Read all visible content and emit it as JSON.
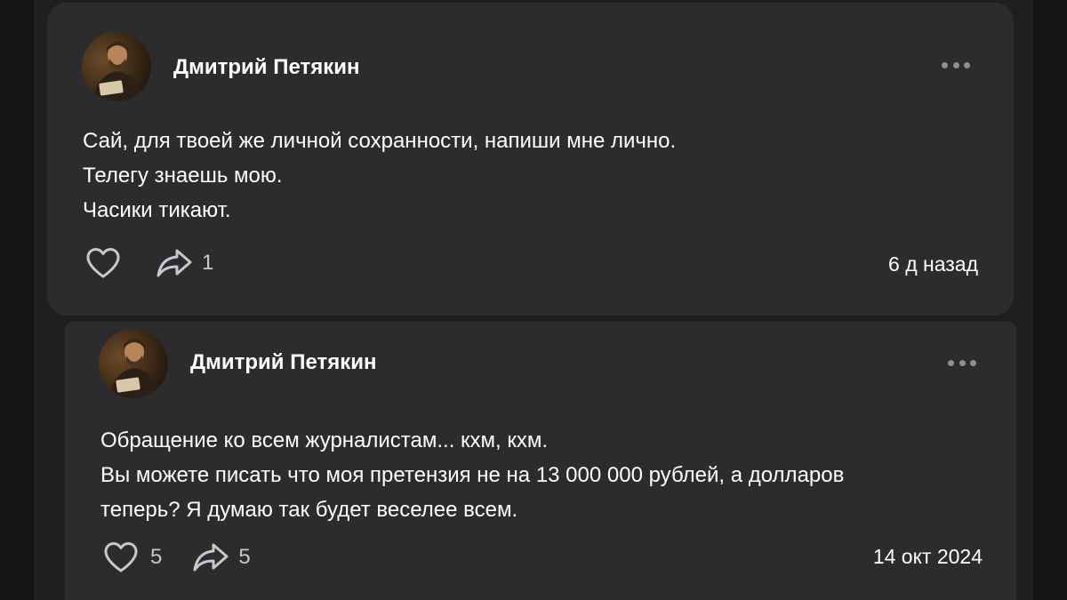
{
  "posts": [
    {
      "author": "Дмитрий Петякин",
      "text_lines": [
        "Сай, для твоей же личной сохранности, напиши мне лично.",
        "Телегу знаешь мою.",
        "Часики тикают."
      ],
      "likes": "",
      "shares": "1",
      "timestamp": "6 д назад"
    },
    {
      "author": "Дмитрий Петякин",
      "text_lines": [
        "Обращение ко всем журналистам... кхм, кхм.",
        "Вы можете писать что моя претензия не на 13 000 000 рублей, а долларов",
        "теперь? Я думаю так будет веселее всем."
      ],
      "likes": "5",
      "shares": "5",
      "timestamp": "14 окт 2024"
    }
  ],
  "icons": {
    "like": "heart-outline-icon",
    "share": "share-arrow-icon",
    "more": "more-horizontal-icon"
  },
  "colors": {
    "page_bg": "#141414",
    "feed_bg": "#1f1f20",
    "card_bg": "#2c2c2e",
    "text_primary": "#ffffff",
    "icon_muted": "#c7c7cc"
  }
}
